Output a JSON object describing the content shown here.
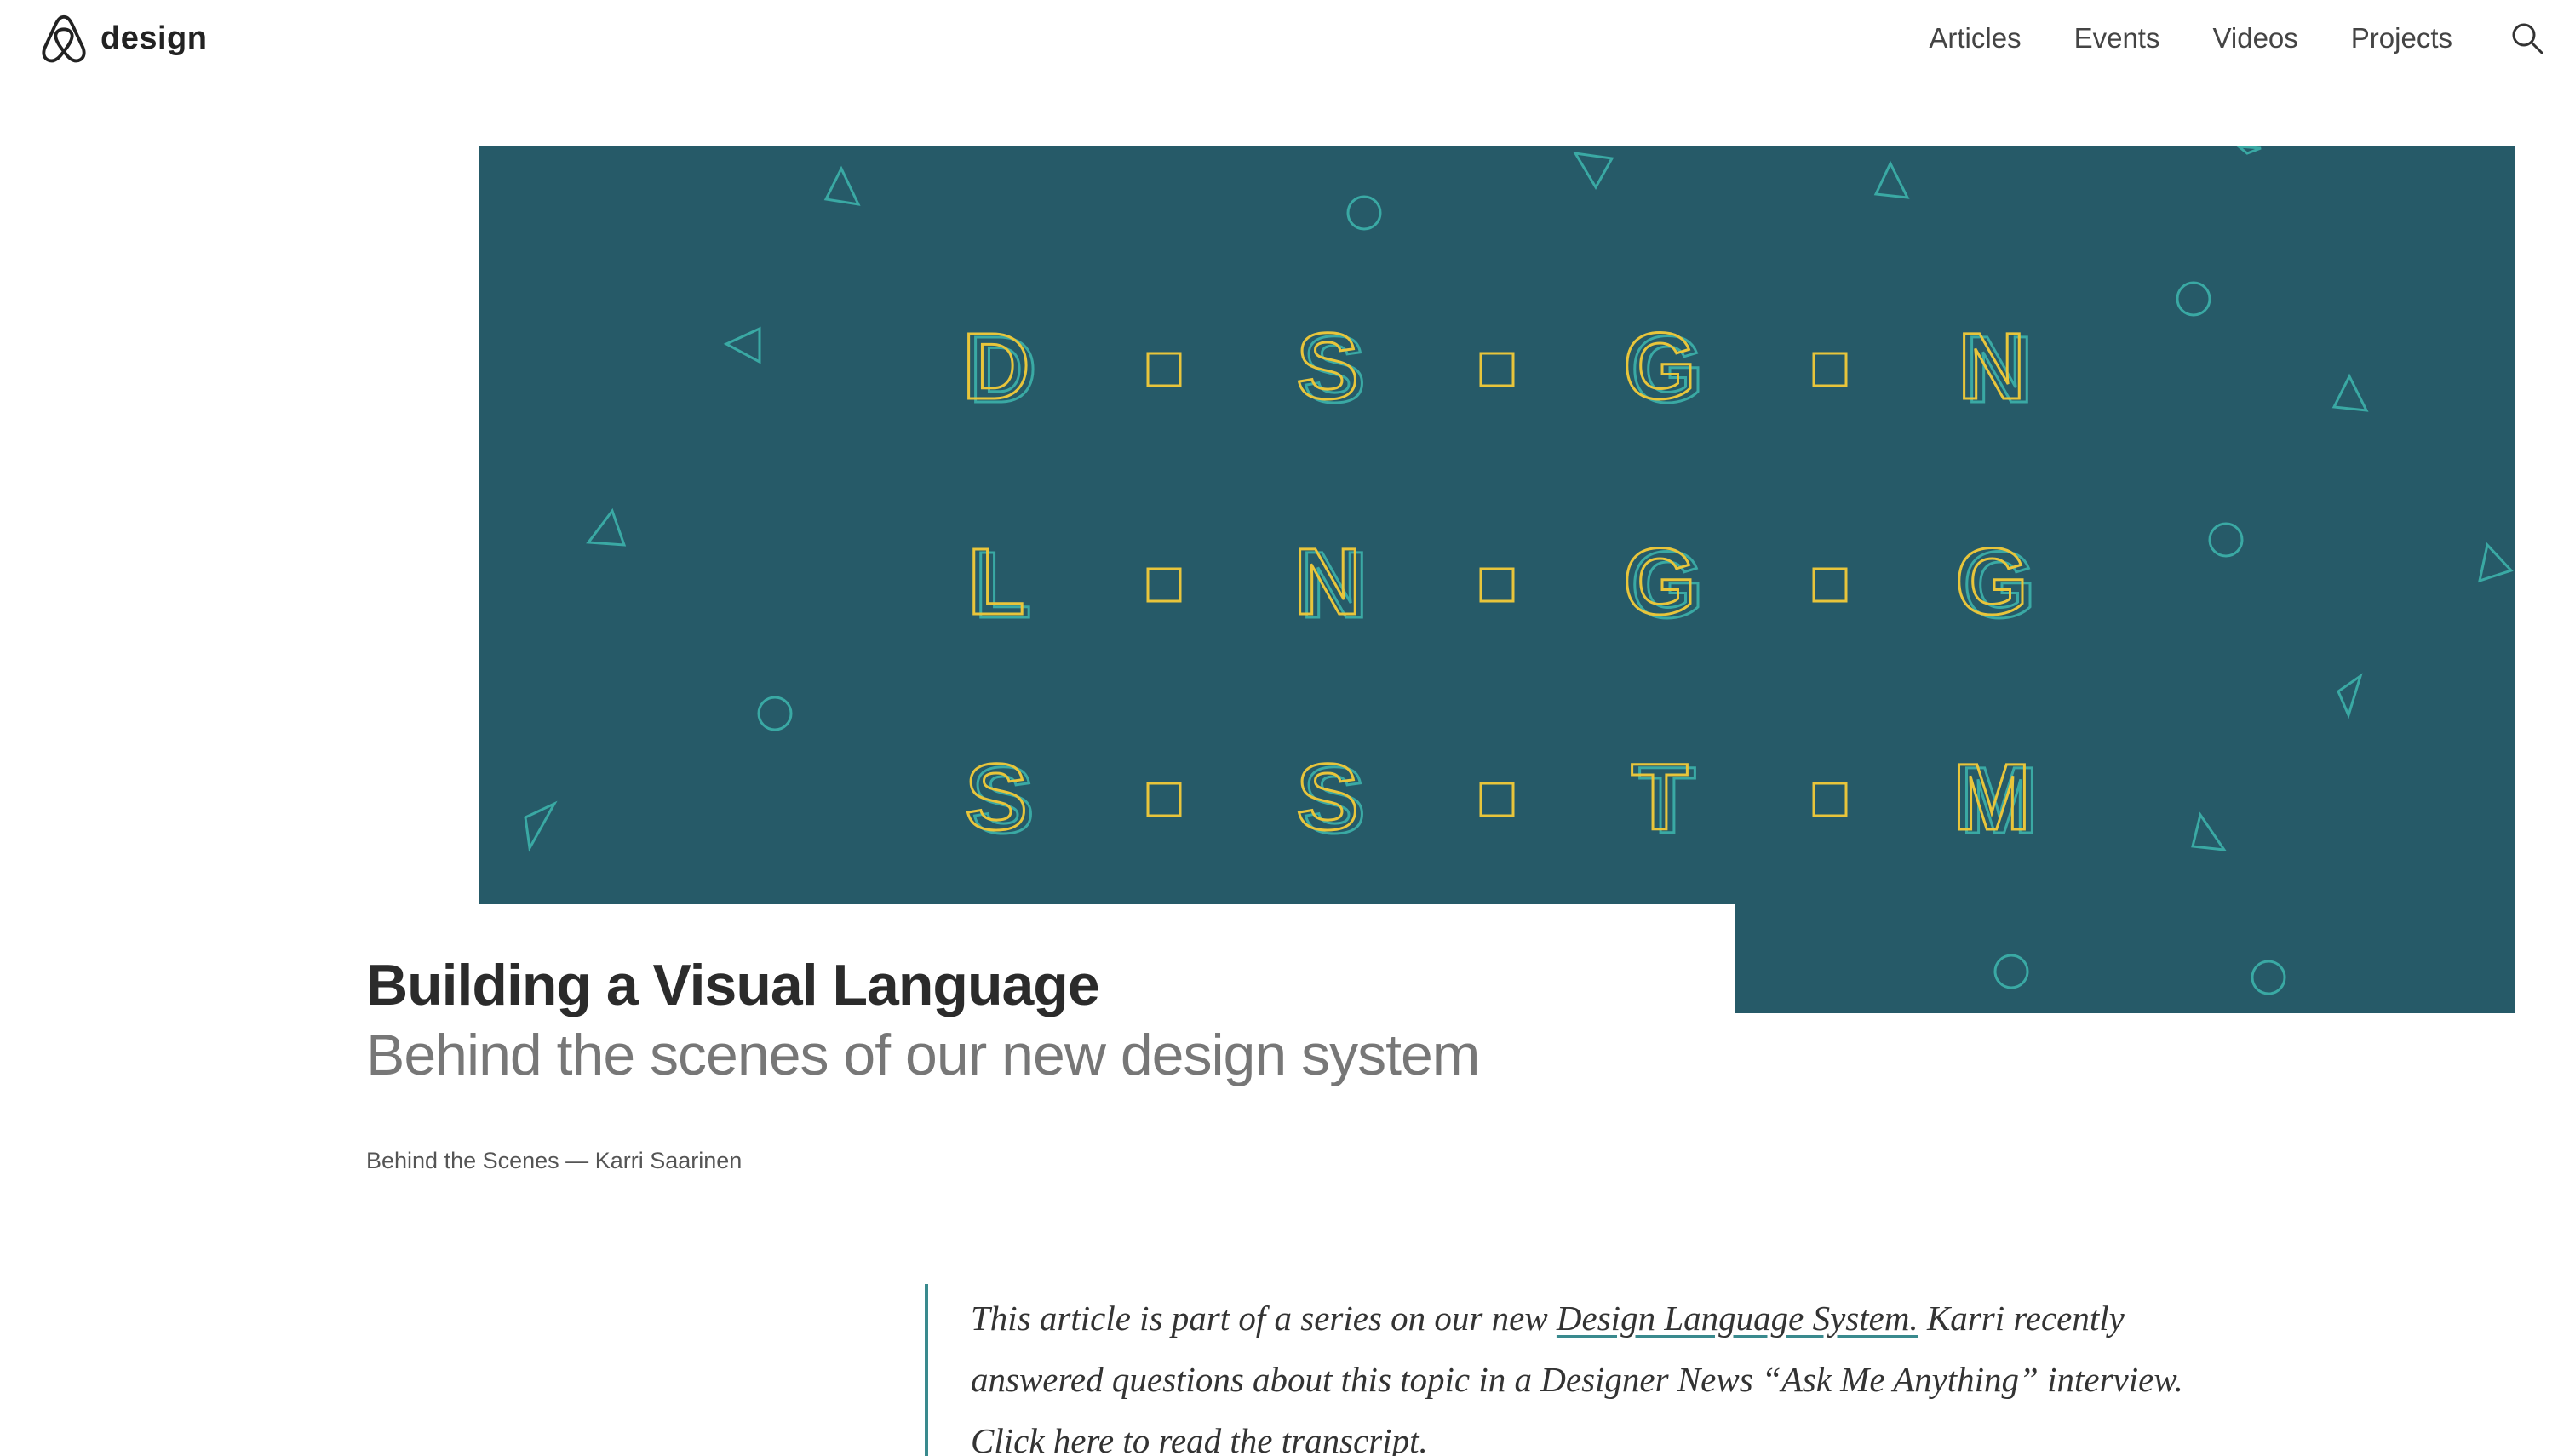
{
  "header": {
    "logo_text": "design",
    "nav": [
      "Articles",
      "Events",
      "Videos",
      "Projects"
    ],
    "search_icon": "search-icon"
  },
  "hero": {
    "background": "#265a68",
    "letter_outline_colors": [
      "#e8c53b",
      "#3aa9a4"
    ],
    "rows": [
      [
        "D",
        "S",
        "G",
        "N"
      ],
      [
        "L",
        "N",
        "G",
        "G"
      ],
      [
        "S",
        "S",
        "T",
        "M"
      ]
    ]
  },
  "article": {
    "title": "Building a Visual Language",
    "subtitle": "Behind the scenes of our new design system",
    "category": "Behind the Scenes",
    "separator": " — ",
    "author": "Karri Saarinen",
    "intro": {
      "before_link": "This article is part of a series on our new ",
      "link_text": "Design Language System.",
      "after_link": " Karri recently answered questions about this topic in a Designer News “Ask Me Anything” interview. Click here to read the transcript."
    }
  }
}
